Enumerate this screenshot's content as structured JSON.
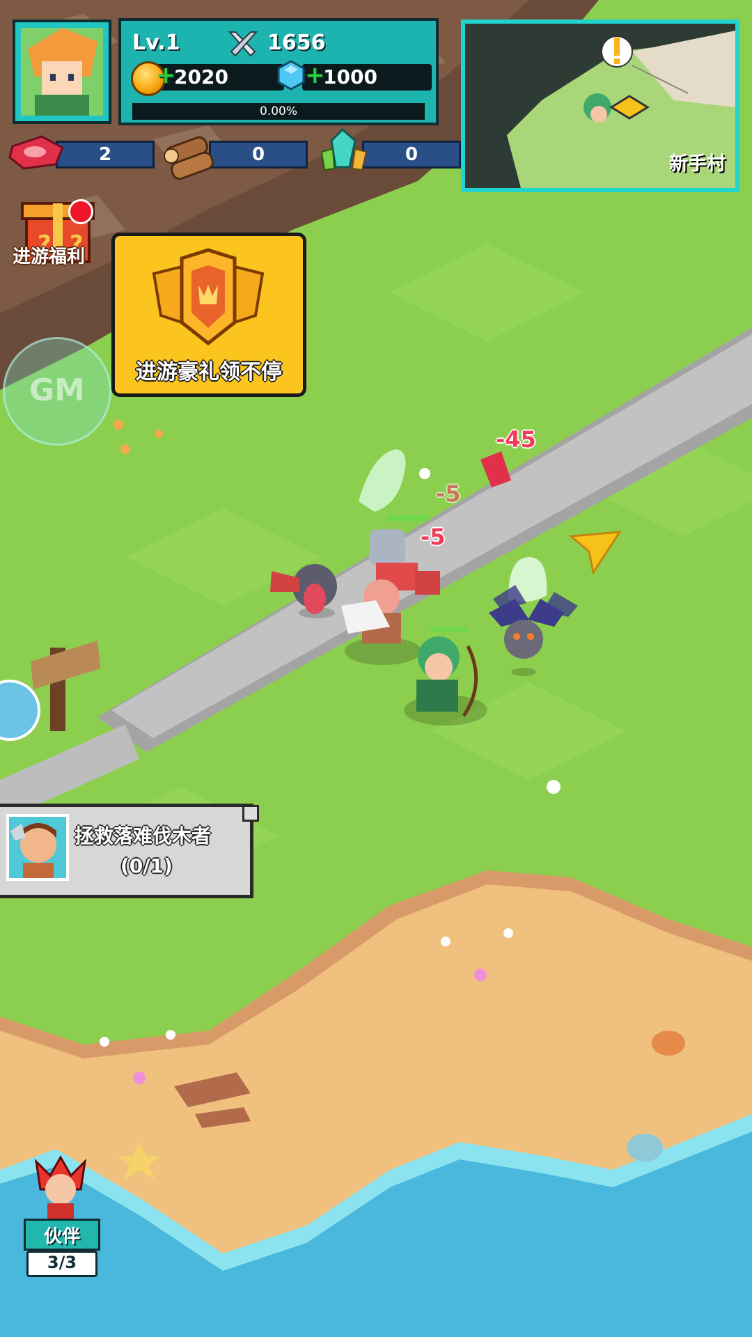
{
  "player": {
    "level": "Lv.1",
    "power": "1656",
    "gold": "2020",
    "diamonds": "1000",
    "exp_percent": "0.00%"
  },
  "resources": {
    "meat": "2",
    "wood": "0",
    "crystal": "0"
  },
  "minimap": {
    "location_name": "新手村"
  },
  "events": {
    "gift_label": "进游福利",
    "promo_text": "进游豪礼领不停",
    "gm_label": "GM"
  },
  "quest": {
    "title": "拯救落难伐木者",
    "progress": "(0/1)"
  },
  "partner": {
    "label": "伙伴",
    "count": "3/3"
  },
  "combat": {
    "damage_numbers": [
      "-45",
      "-5",
      "-5"
    ]
  },
  "colors": {
    "hud_teal": "#1db3ae",
    "grass": "#8ccf4e",
    "sand": "#f0c07e",
    "water": "#4ab7dd",
    "damage": "#f03c5a"
  }
}
